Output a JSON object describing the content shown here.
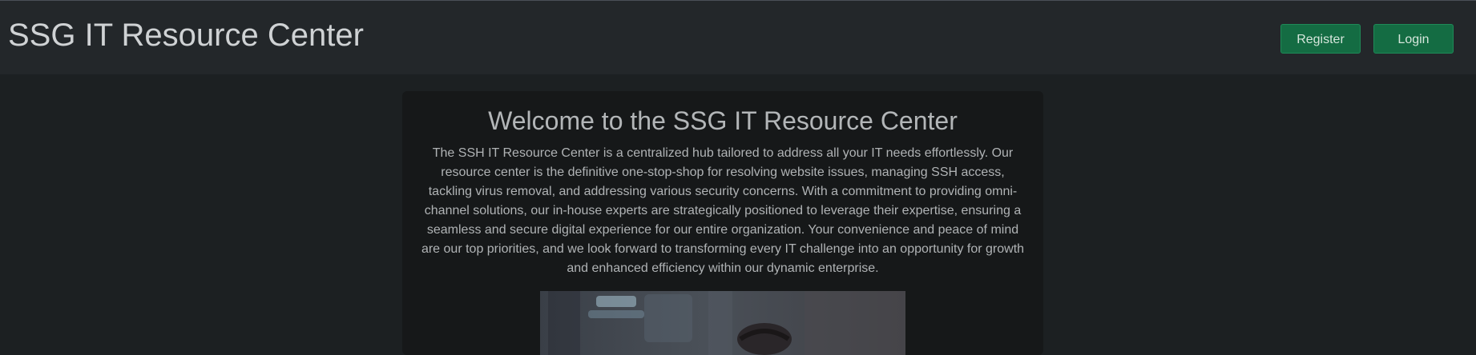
{
  "header": {
    "brand": "SSG IT Resource Center",
    "register_label": "Register",
    "login_label": "Login"
  },
  "main": {
    "title": "Welcome to the SSG IT Resource Center",
    "description": "The SSH IT Resource Center is a centralized hub tailored to address all your IT needs effortlessly. Our resource center is the definitive one-stop-shop for resolving website issues, managing SSH access, tackling virus removal, and addressing various security concerns. With a commitment to providing omni-channel solutions, our in-house experts are strategically positioned to leverage their expertise, ensuring a seamless and secure digital experience for our entire organization. Your convenience and peace of mind are our top priorities, and we look forward to transforming every IT challenge into an opportunity for growth and enhanced efficiency within our dynamic enterprise."
  },
  "colors": {
    "page_background": "#1c2022",
    "navbar_background": "#23272a",
    "card_background": "#161819",
    "button_green": "#146c43"
  }
}
